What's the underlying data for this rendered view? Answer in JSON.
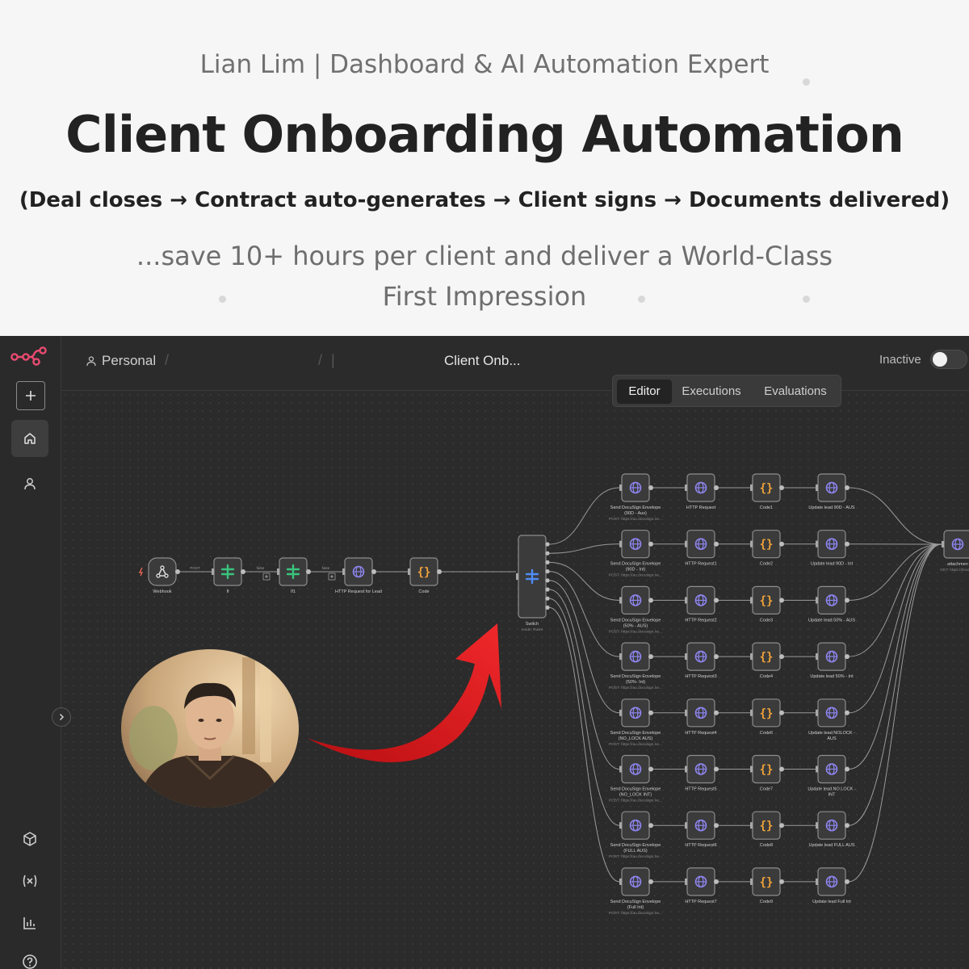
{
  "banner": {
    "author": "Lian Lim | Dashboard & AI Automation Expert",
    "headline": "Client Onboarding Automation",
    "flow": "(Deal closes → Contract auto-generates → Client signs → Documents delivered)",
    "tagline_line1": "...save 10+ hours per client and deliver a World-Class",
    "tagline_line2": "First Impression"
  },
  "topbar": {
    "project": "Personal",
    "workflow_name": "Client Onb...",
    "status": "Inactive",
    "tabs": {
      "editor": "Editor",
      "executions": "Executions",
      "evaluations": "Evaluations"
    },
    "active_tab": "Editor"
  },
  "sidebar": {
    "icons": [
      "logo-icon",
      "add-icon",
      "home-icon",
      "user-icon",
      "templates-icon",
      "variables-icon",
      "insights-icon",
      "help-icon"
    ]
  },
  "workflow": {
    "trigger": [
      {
        "label": "Webhook",
        "icon": "webhook-icon",
        "edge_label": "POST"
      },
      {
        "label": "If",
        "icon": "if-icon",
        "edge_label": "false"
      },
      {
        "label": "If1",
        "icon": "if-icon",
        "edge_label": "false"
      },
      {
        "label": "HTTP Request for Lead",
        "icon": "globe-icon"
      },
      {
        "label": "Code",
        "icon": "code-icon"
      }
    ],
    "switch": {
      "label": "Switch",
      "sub": "mode: Rules",
      "icon": "switch-icon"
    },
    "rows": [
      {
        "send": [
          "Send DocuSign Envelope",
          "(90D - Aus)"
        ],
        "send_sub": "POST: https://au.docusign.ne...",
        "http": "HTTP Request",
        "code": "Code1",
        "update": [
          "Update lead 90D - AUS"
        ]
      },
      {
        "send": [
          "Send DocuSign Envelope",
          "(90D - Int)"
        ],
        "send_sub": "POST: https://au.docusign.ne...",
        "http": "HTTP Request1",
        "code": "Code2",
        "update": [
          "Update lead 90D - Int"
        ]
      },
      {
        "send": [
          "Send DocuSign Envelope",
          "(50% - AUS)"
        ],
        "send_sub": "POST: https://au.docusign.ne...",
        "http": "HTTP Request2",
        "code": "Code3",
        "update": [
          "Update lead 50% - AUS"
        ]
      },
      {
        "send": [
          "Send DocuSign Envelope",
          "(50%- Int)"
        ],
        "send_sub": "POST: https://au.docusign.ne...",
        "http": "HTTP Request3",
        "code": "Code4",
        "update": [
          "Update lead 50% - Int"
        ]
      },
      {
        "send": [
          "Send DocuSign Envelope",
          "(NO_LOCK AUS)"
        ],
        "send_sub": "POST: https://au.docusign.ne...",
        "http": "HTTP Request4",
        "code": "Code6",
        "update": [
          "Update lead NOLOCK -",
          "AUS"
        ]
      },
      {
        "send": [
          "Send DocuSign Envelope",
          "(NO_LOCK INT)"
        ],
        "send_sub": "POST: https://au.docusign.ne...",
        "http": "HTTP Request5",
        "code": "Code7",
        "update": [
          "Update lead NO LOCK -",
          "INT"
        ]
      },
      {
        "send": [
          "Send DocuSign Envelope",
          "(FULL AUS)"
        ],
        "send_sub": "POST: https://au.docusign.ne...",
        "http": "HTTP Request6",
        "code": "Code8",
        "update": [
          "Update lead FULL AUS"
        ]
      },
      {
        "send": [
          "Send DocuSign Envelope",
          "(Full Int)"
        ],
        "send_sub": "POST: https://au.docusign.ne...",
        "http": "HTTP Request7",
        "code": "Code9",
        "update": [
          "Update lead Full Int"
        ]
      }
    ],
    "final": {
      "label": "attachmen",
      "sub": "GET: https://drive.go"
    }
  },
  "colors": {
    "canvas": "#2b2b2b",
    "node_fill": "#3b3b3b",
    "node_stroke": "#8d8d8d",
    "connector": "#9a9a9a",
    "globe": "#8e86f0",
    "code": "#f0a33a",
    "if": "#39c47d",
    "switch": "#4f8cf5",
    "brand": "#ea4b71",
    "arrow": "#e0191c"
  }
}
